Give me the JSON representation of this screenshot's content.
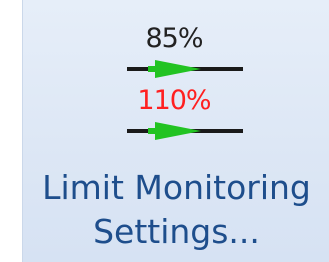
{
  "button": {
    "label_line1": "Limit Monitoring",
    "label_line2": "Settings...",
    "text_color": "#1e4e8c"
  },
  "icon": {
    "name": "limit-monitoring-icon",
    "warning_threshold": "85%",
    "warning_color": "#222222",
    "limit_threshold": "110%",
    "limit_color": "#ff2020",
    "arrow_color": "#22c322",
    "line_color": "#1a1a1a"
  }
}
